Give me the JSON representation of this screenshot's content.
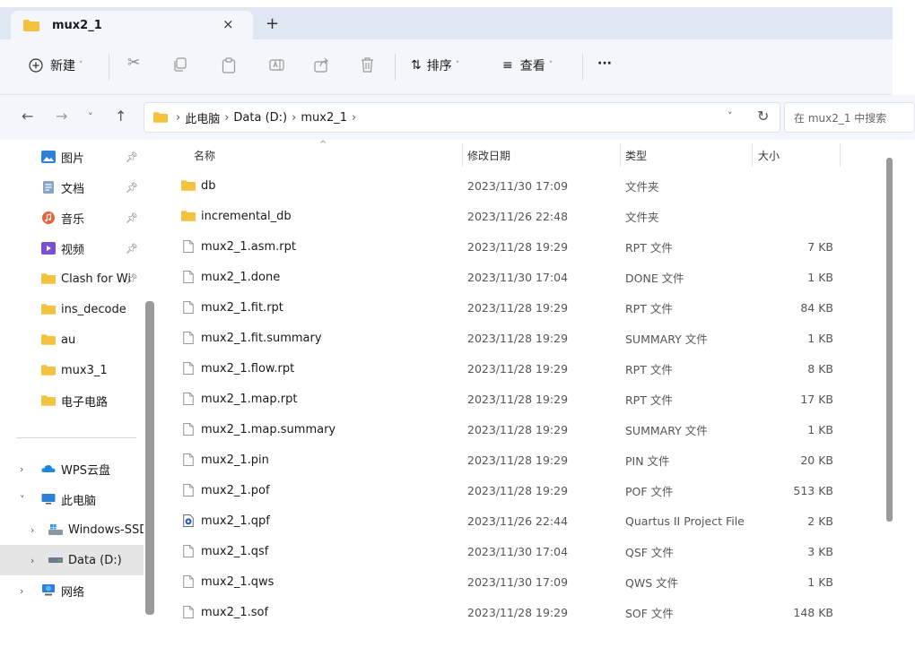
{
  "window": {
    "tab_title": "mux2_1",
    "tab_close": "×",
    "new_tab": "+"
  },
  "toolbar": {
    "new_label": "新建",
    "sort_label": "排序",
    "view_label": "查看",
    "more_label": "···"
  },
  "address": {
    "crumbs": [
      "此电脑",
      "Data (D:)",
      "mux2_1"
    ],
    "search_placeholder": "在 mux2_1 中搜索"
  },
  "nav": {
    "quick_access": [
      {
        "label": "图片",
        "icon": "pictures-icon",
        "pinned": true
      },
      {
        "label": "文档",
        "icon": "documents-icon",
        "pinned": true
      },
      {
        "label": "音乐",
        "icon": "music-icon",
        "pinned": true
      },
      {
        "label": "视频",
        "icon": "videos-icon",
        "pinned": true
      },
      {
        "label": "Clash for Wi",
        "icon": "folder-icon",
        "pinned": true
      },
      {
        "label": "ins_decode",
        "icon": "folder-icon",
        "pinned": false
      },
      {
        "label": "au",
        "icon": "folder-icon",
        "pinned": false
      },
      {
        "label": "mux3_1",
        "icon": "folder-icon",
        "pinned": false
      },
      {
        "label": "电子电路",
        "icon": "folder-icon",
        "pinned": false
      }
    ],
    "tree": [
      {
        "label": "WPS云盘",
        "icon": "cloud-icon",
        "expander": "chevron-right-icon"
      },
      {
        "label": "此电脑",
        "icon": "computer-icon",
        "expander": "chevron-down-icon"
      },
      {
        "label": "Windows-SSD",
        "icon": "drive-icon",
        "expander": "chevron-right-icon"
      },
      {
        "label": "Data (D:)",
        "icon": "drive-icon",
        "expander": "chevron-right-icon",
        "selected": true
      },
      {
        "label": "网络",
        "icon": "network-icon",
        "expander": "chevron-right-icon"
      }
    ]
  },
  "list": {
    "columns": {
      "name": "名称",
      "date": "修改日期",
      "type": "类型",
      "size": "大小"
    },
    "files": [
      {
        "name": "db",
        "date": "2023/11/30 17:09",
        "type": "文件夹",
        "size": "",
        "icon": "folder-icon"
      },
      {
        "name": "incremental_db",
        "date": "2023/11/26 22:48",
        "type": "文件夹",
        "size": "",
        "icon": "folder-icon"
      },
      {
        "name": "mux2_1.asm.rpt",
        "date": "2023/11/28 19:29",
        "type": "RPT 文件",
        "size": "7 KB",
        "icon": "file-icon"
      },
      {
        "name": "mux2_1.done",
        "date": "2023/11/30 17:04",
        "type": "DONE 文件",
        "size": "1 KB",
        "icon": "file-icon"
      },
      {
        "name": "mux2_1.fit.rpt",
        "date": "2023/11/28 19:29",
        "type": "RPT 文件",
        "size": "84 KB",
        "icon": "file-icon"
      },
      {
        "name": "mux2_1.fit.summary",
        "date": "2023/11/28 19:29",
        "type": "SUMMARY 文件",
        "size": "1 KB",
        "icon": "file-icon"
      },
      {
        "name": "mux2_1.flow.rpt",
        "date": "2023/11/28 19:29",
        "type": "RPT 文件",
        "size": "8 KB",
        "icon": "file-icon"
      },
      {
        "name": "mux2_1.map.rpt",
        "date": "2023/11/28 19:29",
        "type": "RPT 文件",
        "size": "17 KB",
        "icon": "file-icon"
      },
      {
        "name": "mux2_1.map.summary",
        "date": "2023/11/28 19:29",
        "type": "SUMMARY 文件",
        "size": "1 KB",
        "icon": "file-icon"
      },
      {
        "name": "mux2_1.pin",
        "date": "2023/11/28 19:29",
        "type": "PIN 文件",
        "size": "20 KB",
        "icon": "file-icon"
      },
      {
        "name": "mux2_1.pof",
        "date": "2023/11/28 19:29",
        "type": "POF 文件",
        "size": "513 KB",
        "icon": "file-icon"
      },
      {
        "name": "mux2_1.qpf",
        "date": "2023/11/26 22:44",
        "type": "Quartus II Project File",
        "size": "2 KB",
        "icon": "quartus-project-icon"
      },
      {
        "name": "mux2_1.qsf",
        "date": "2023/11/30 17:04",
        "type": "QSF 文件",
        "size": "3 KB",
        "icon": "file-icon"
      },
      {
        "name": "mux2_1.qws",
        "date": "2023/11/30 17:09",
        "type": "QWS 文件",
        "size": "1 KB",
        "icon": "file-icon"
      },
      {
        "name": "mux2_1.sof",
        "date": "2023/11/28 19:29",
        "type": "SOF 文件",
        "size": "148 KB",
        "icon": "file-icon"
      }
    ]
  },
  "colors": {
    "folder": "#f3c33f",
    "accent": "#1f6fd1",
    "chrome_bg": "#f3f6fa",
    "tab_strip": "#dfe7f2"
  }
}
